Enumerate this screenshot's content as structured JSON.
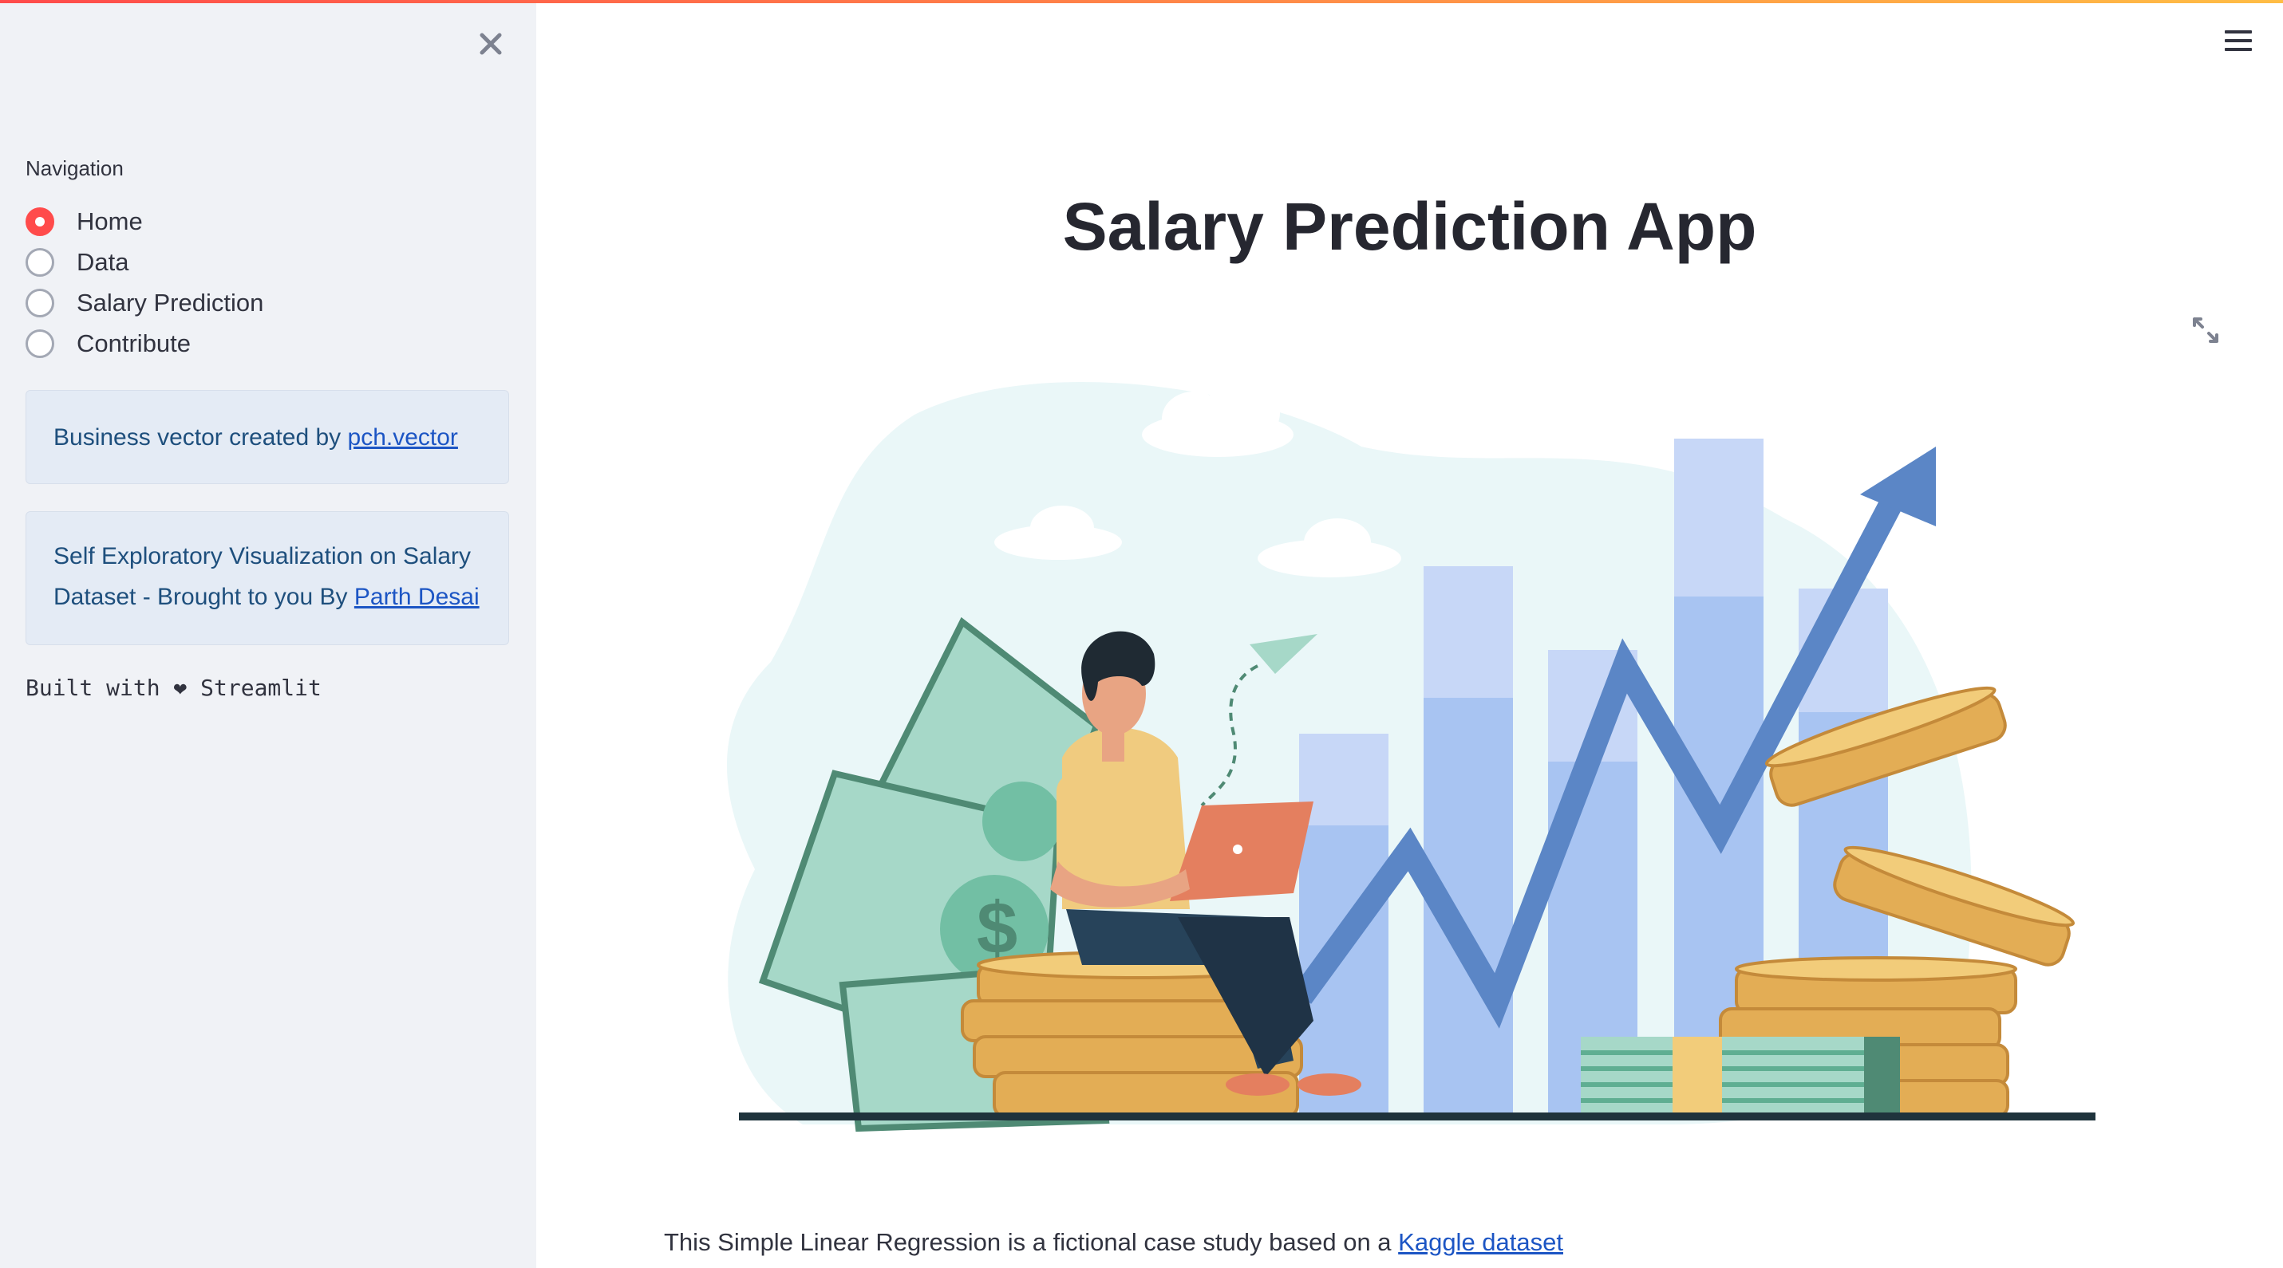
{
  "sidebar": {
    "nav_label": "Navigation",
    "options": [
      {
        "label": "Home",
        "selected": true
      },
      {
        "label": "Data",
        "selected": false
      },
      {
        "label": "Salary Prediction",
        "selected": false
      },
      {
        "label": "Contribute",
        "selected": false
      }
    ],
    "credit_box": {
      "text": "Business vector created by ",
      "link": "pch.vector"
    },
    "about_box": {
      "line1": "Self Exploratory Visualization on Salary",
      "line2": "Dataset - Brought to you By ",
      "link": "Parth Desai"
    },
    "built_with": "Built with ❤ Streamlit"
  },
  "main": {
    "title": "Salary Prediction App",
    "footer_text": "This Simple Linear Regression is a fictional case study based on a ",
    "footer_link": "Kaggle dataset"
  },
  "colors": {
    "accent": "#ff4b4b",
    "sidebar_bg": "#f0f2f6",
    "info_bg": "#e4ebf5",
    "link": "#1c55c4"
  },
  "icons": [
    "close-icon",
    "hamburger-menu-icon",
    "fullscreen-icon"
  ]
}
